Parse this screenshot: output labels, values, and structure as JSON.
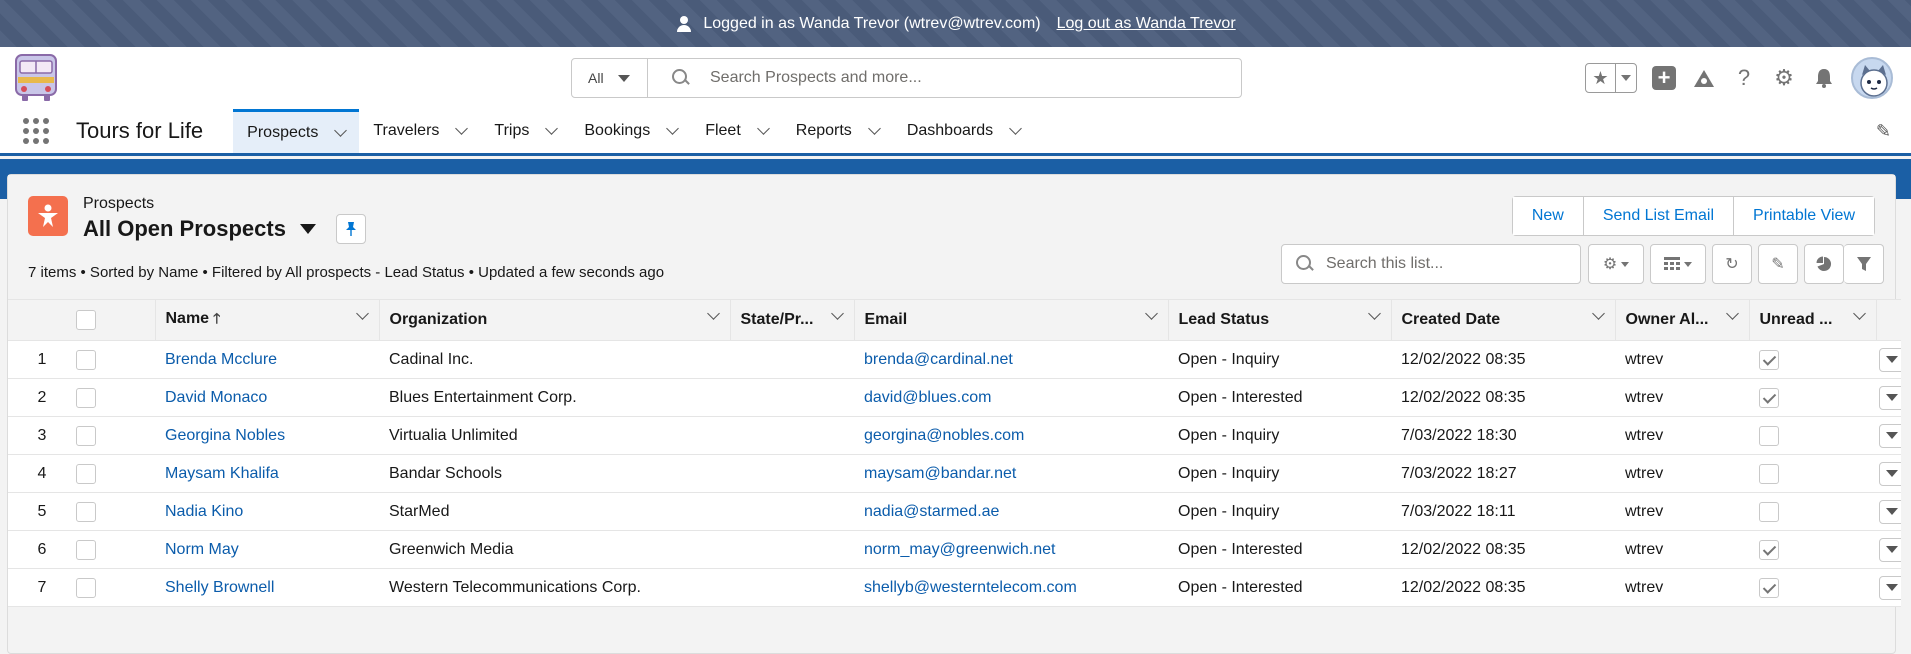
{
  "impersonation": {
    "text": "Logged in as Wanda Trevor (wtrev@wtrev.com)",
    "logout": "Log out as Wanda Trevor"
  },
  "global_search": {
    "scope": "All",
    "placeholder": "Search Prospects and more..."
  },
  "app": {
    "name": "Tours for Life",
    "nav": [
      {
        "label": "Prospects",
        "active": true
      },
      {
        "label": "Travelers"
      },
      {
        "label": "Trips"
      },
      {
        "label": "Bookings"
      },
      {
        "label": "Fleet"
      },
      {
        "label": "Reports"
      },
      {
        "label": "Dashboards"
      }
    ]
  },
  "list": {
    "object_type": "Prospects",
    "view_name": "All Open Prospects",
    "summary": "7 items • Sorted by Name • Filtered by All prospects - Lead Status • Updated a few seconds ago",
    "actions": [
      "New",
      "Send List Email",
      "Printable View"
    ],
    "search_placeholder": "Search this list..."
  },
  "table": {
    "columns": [
      "Name",
      "Organization",
      "State/Pr...",
      "Email",
      "Lead Status",
      "Created Date",
      "Owner Al...",
      "Unread ..."
    ],
    "rows": [
      {
        "n": "1",
        "name": "Brenda Mcclure",
        "org": "Cadinal Inc.",
        "state": "",
        "email": "brenda@cardinal.net",
        "status": "Open - Inquiry",
        "created": "12/02/2022 08:35",
        "owner": "wtrev",
        "unread": true
      },
      {
        "n": "2",
        "name": "David Monaco",
        "org": "Blues Entertainment Corp.",
        "state": "",
        "email": "david@blues.com",
        "status": "Open - Interested",
        "created": "12/02/2022 08:35",
        "owner": "wtrev",
        "unread": true
      },
      {
        "n": "3",
        "name": "Georgina Nobles",
        "org": "Virtualia Unlimited",
        "state": "",
        "email": "georgina@nobles.com",
        "status": "Open - Inquiry",
        "created": "7/03/2022 18:30",
        "owner": "wtrev",
        "unread": false
      },
      {
        "n": "4",
        "name": "Maysam Khalifa",
        "org": "Bandar Schools",
        "state": "",
        "email": "maysam@bandar.net",
        "status": "Open - Inquiry",
        "created": "7/03/2022 18:27",
        "owner": "wtrev",
        "unread": false
      },
      {
        "n": "5",
        "name": "Nadia Kino",
        "org": "StarMed",
        "state": "",
        "email": "nadia@starmed.ae",
        "status": "Open - Inquiry",
        "created": "7/03/2022 18:11",
        "owner": "wtrev",
        "unread": false
      },
      {
        "n": "6",
        "name": "Norm May",
        "org": "Greenwich Media",
        "state": "",
        "email": "norm_may@greenwich.net",
        "status": "Open - Interested",
        "created": "12/02/2022 08:35",
        "owner": "wtrev",
        "unread": true
      },
      {
        "n": "7",
        "name": "Shelly Brownell",
        "org": "Western Telecommunications Corp.",
        "state": "",
        "email": "shellyb@westerntelecom.com",
        "status": "Open - Interested",
        "created": "12/02/2022 08:35",
        "owner": "wtrev",
        "unread": true
      }
    ]
  },
  "colors": {
    "brand": "#0176d3",
    "impersonation_bar": "#4c5e7d",
    "object_icon": "#f4704e"
  }
}
